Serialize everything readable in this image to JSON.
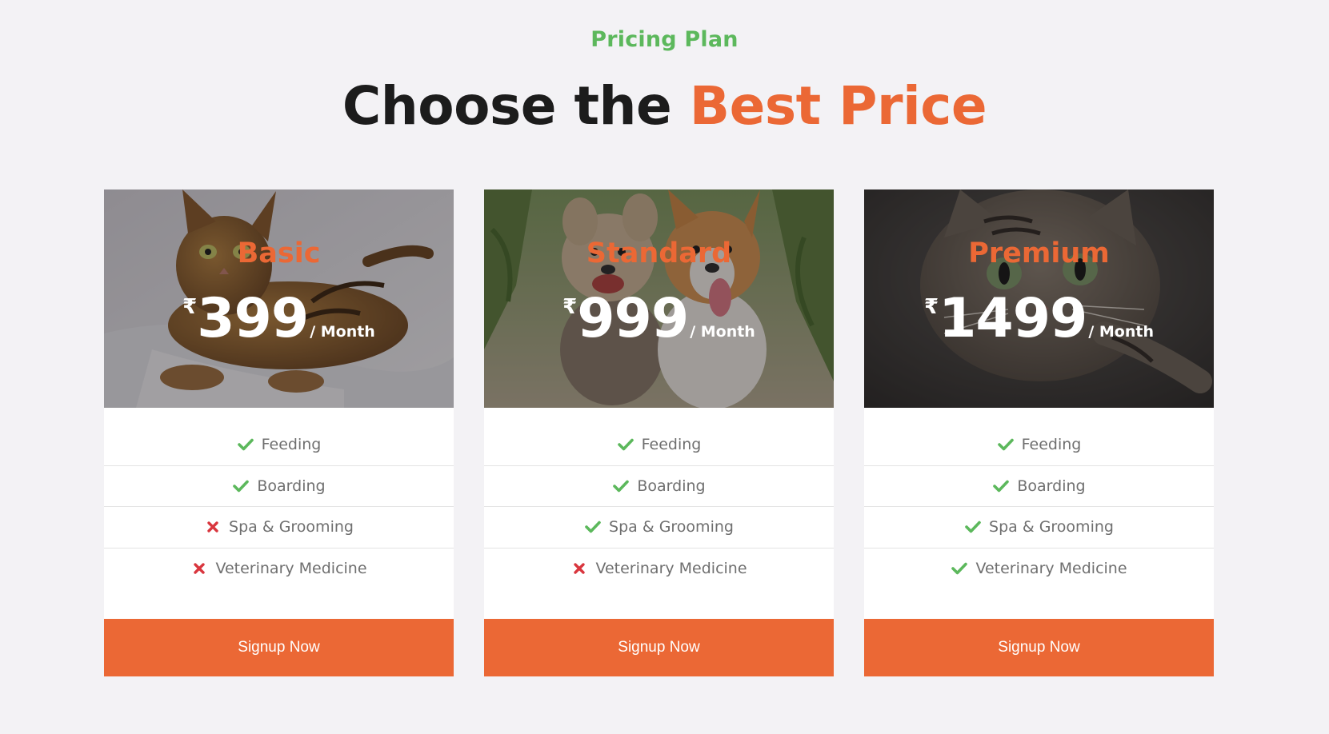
{
  "header": {
    "eyebrow": "Pricing Plan",
    "title_main": "Choose the ",
    "title_accent": "Best Price"
  },
  "colors": {
    "accent": "#eb6835",
    "green": "#5cb85c",
    "red": "#d9363e",
    "heading": "#1c1c1c",
    "background": "#f3f2f5"
  },
  "plans": [
    {
      "name": "Basic",
      "currency": "₹",
      "price": "399",
      "period": "/ Month",
      "image": "cat-on-bed-photo",
      "features": [
        {
          "label": "Feeding",
          "included": true,
          "icon": "check-icon"
        },
        {
          "label": "Boarding",
          "included": true,
          "icon": "check-icon"
        },
        {
          "label": "Spa & Grooming",
          "included": false,
          "icon": "x-icon"
        },
        {
          "label": "Veterinary Medicine",
          "included": false,
          "icon": "x-icon"
        }
      ],
      "button": "Signup Now"
    },
    {
      "name": "Standard",
      "currency": "₹",
      "price": "999",
      "period": "/ Month",
      "image": "two-dogs-photo",
      "features": [
        {
          "label": "Feeding",
          "included": true,
          "icon": "check-icon"
        },
        {
          "label": "Boarding",
          "included": true,
          "icon": "check-icon"
        },
        {
          "label": "Spa & Grooming",
          "included": true,
          "icon": "check-icon"
        },
        {
          "label": "Veterinary Medicine",
          "included": false,
          "icon": "x-icon"
        }
      ],
      "button": "Signup Now"
    },
    {
      "name": "Premium",
      "currency": "₹",
      "price": "1499",
      "period": "/ Month",
      "image": "tabby-cat-photo",
      "features": [
        {
          "label": "Feeding",
          "included": true,
          "icon": "check-icon"
        },
        {
          "label": "Boarding",
          "included": true,
          "icon": "check-icon"
        },
        {
          "label": "Spa & Grooming",
          "included": true,
          "icon": "check-icon"
        },
        {
          "label": "Veterinary Medicine",
          "included": true,
          "icon": "check-icon"
        }
      ],
      "button": "Signup Now"
    }
  ]
}
